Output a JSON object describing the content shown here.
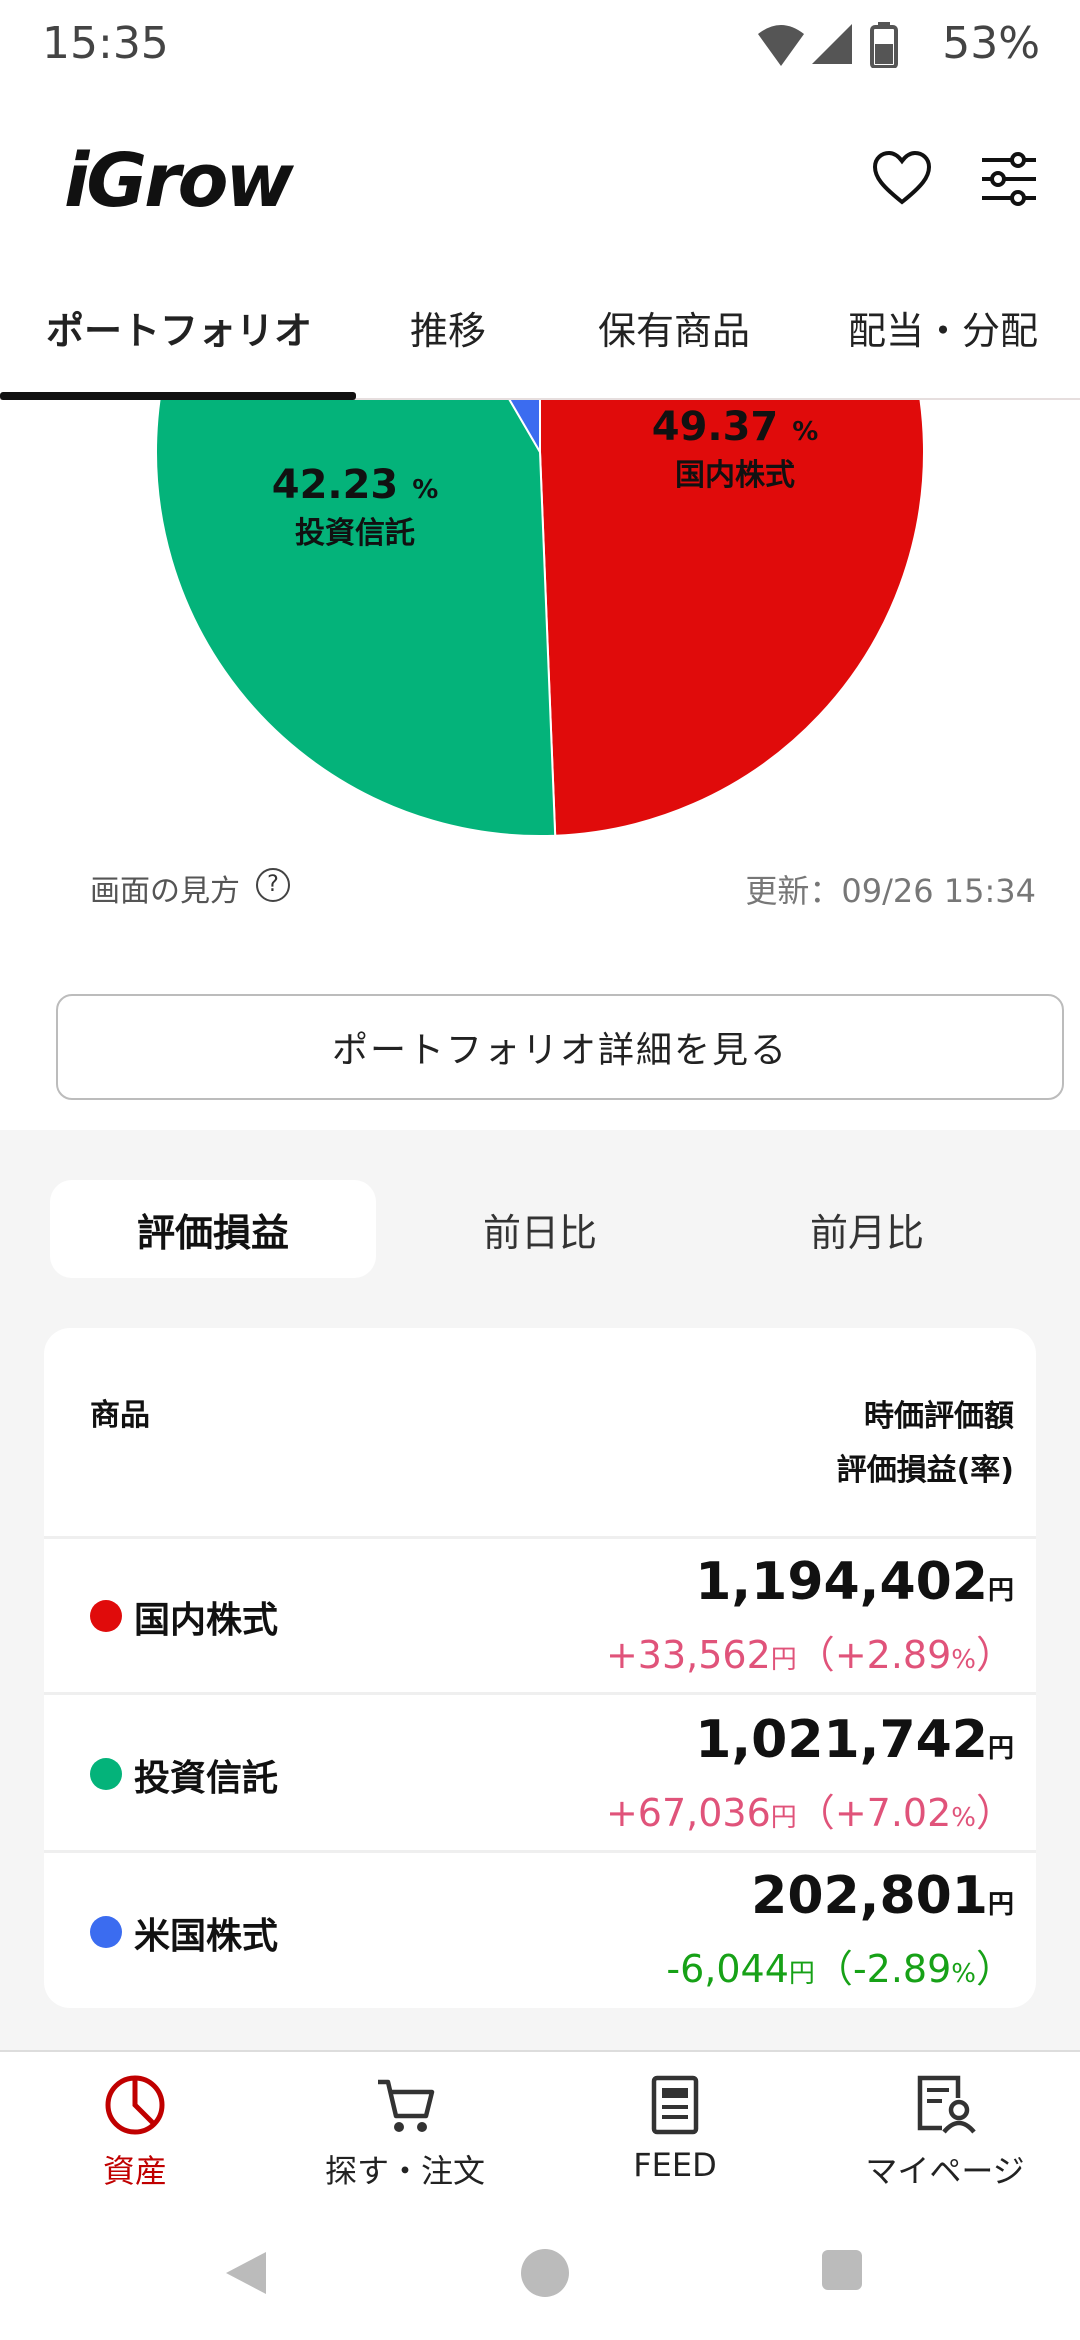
{
  "status_bar": {
    "time": "15:35",
    "battery": "53%"
  },
  "header": {
    "logo": "iGrow"
  },
  "tabs": [
    {
      "label": "ポートフォリオ",
      "active": true
    },
    {
      "label": "推移"
    },
    {
      "label": "保有商品"
    },
    {
      "label": "配当・分配"
    }
  ],
  "chart_data": {
    "type": "pie",
    "slices": [
      {
        "name": "国内株式",
        "percent": 49.37,
        "color": "#e00b0b"
      },
      {
        "name": "投資信託",
        "percent": 42.23,
        "color": "#04b37a"
      },
      {
        "name": "米国株式",
        "percent": 8.4,
        "color": "#3b6cf0"
      }
    ],
    "pct_unit": "%"
  },
  "chart_footer": {
    "howto": "画面の見方",
    "help_symbol": "?",
    "updated": "更新：09/26 15:34"
  },
  "detail_button": "ポートフォリオ詳細を見る",
  "segments": [
    {
      "label": "評価損益",
      "active": true
    },
    {
      "label": "前日比"
    },
    {
      "label": "前月比"
    }
  ],
  "table": {
    "col_product": "商品",
    "col_value_1": "時価評価額",
    "col_value_2": "評価損益(率)",
    "rows": [
      {
        "name": "国内株式",
        "color": "#e00b0b",
        "amount": "1,194,402",
        "gain": "+33,562",
        "rate": "+2.89",
        "direction": "up"
      },
      {
        "name": "投資信託",
        "color": "#04b37a",
        "amount": "1,021,742",
        "gain": "+67,036",
        "rate": "+7.02",
        "direction": "up"
      },
      {
        "name": "米国株式",
        "color": "#3b6cf0",
        "amount": "202,801",
        "gain": "-6,044",
        "rate": "-2.89",
        "direction": "down"
      }
    ],
    "yen": "円",
    "pct": "%"
  },
  "bottom_nav": [
    {
      "label": "資産",
      "icon": "pie-chart-icon",
      "active": true
    },
    {
      "label": "探す・注文",
      "icon": "cart-icon"
    },
    {
      "label": "FEED",
      "icon": "feed-icon"
    },
    {
      "label": "マイページ",
      "icon": "profile-icon"
    }
  ]
}
